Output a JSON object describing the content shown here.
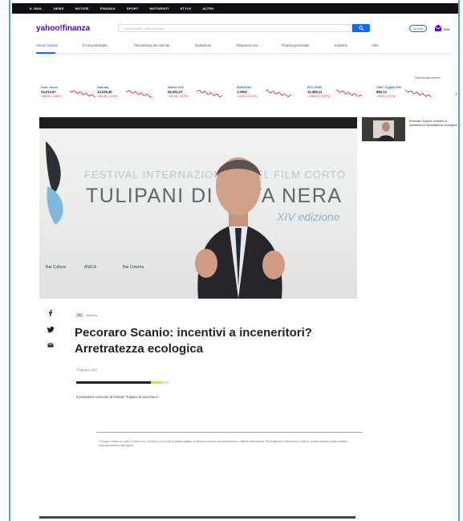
{
  "topnav": {
    "items": [
      "IL MAIL",
      "NEWS",
      "NOTIZIE",
      "FINANZA",
      "SPORT",
      "MOTORISTI",
      "STYLE",
      "ALTRO"
    ]
  },
  "header": {
    "logo_main": "yahoo!",
    "logo_sub": "finanza",
    "search_placeholder": "Cerca notizie e titoli azionari",
    "login_label": "Accedi",
    "mail_label": "Mail"
  },
  "subnav": {
    "items": [
      "Home Finanza",
      "Il mio portafoglio",
      "Panoramica dei mercati",
      "Quotazioni",
      "Risparmio con...",
      "Finanza personale",
      "Industrie",
      "Altro"
    ]
  },
  "tickers": {
    "link": "Dati mercato essere",
    "items": [
      {
        "name": "Dow Jones",
        "value": "34,015,87",
        "change": "-188,62 (-0,55%)"
      },
      {
        "name": "Nasdaq",
        "value": "14,038,46",
        "change": "-162,48 (-1,14%)"
      },
      {
        "name": "Nikkei 225",
        "value": "28,291,07",
        "change": "-190,36 (-0,67%)"
      },
      {
        "name": "EUR/USD",
        "value": "1,0000",
        "change": "-0,0010 (-0,10%)"
      },
      {
        "name": "BTC-EUR",
        "value": "31.289,11",
        "change": "-1.380,22 (-4,22%)"
      },
      {
        "name": "CMC Crypto 200",
        "value": "860,14",
        "change": "-20,90 (-2,37%)"
      }
    ]
  },
  "video": {
    "line1": "FESTIVAL INTERNAZIONALE DEL FILM CORTO",
    "line2": "TULIPANI DI SETA NERA",
    "line3": "XIV edizione",
    "logos": [
      "Rai Cultura",
      "ANICA",
      "Rai Cinema"
    ]
  },
  "side_story": {
    "text": "Pecoraro Scanio: incentivi a inceneritori? Arretratezza ecologica"
  },
  "article": {
    "provider": "Italpress",
    "title": "Pecoraro Scanio: incentivi a inceneritori? Arretratezza ecologica",
    "date": "13 giugno 2022",
    "progress": 0.82,
    "caption": "Il presidente Univerde al festival \"Tulipani di Seta Nera\"",
    "note": "Il Gruppo Yahoo! fa parte di Yahoo! Inc. Cliccando su un link di questa pagina, potremmo ricevere una commissione. Ulteriori informazioni. Per migliorare l'esperienza di lettura, questo articolo è stato tradotto automaticamente dall'inglese."
  },
  "colors": {
    "brand": "#6001d2",
    "accent": "#0f69ff",
    "negative": "#eb0f29"
  }
}
